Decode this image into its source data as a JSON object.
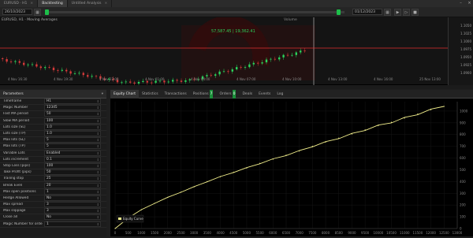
{
  "titlebar": {
    "tabs": [
      {
        "label": "EURUSD · H1",
        "active": false
      },
      {
        "label": "Backtesting",
        "active": true
      },
      {
        "label": "Untitled Analysis",
        "active": false
      }
    ]
  },
  "toolbar": {
    "start_date": "26/10/2023",
    "end_date": "01/12/2023"
  },
  "chart": {
    "info": "EURUSD, H1 · Moving Averages",
    "price_label": "57,587.45 | 19,362.41",
    "note": "Volume",
    "price_ticks": [
      "1.1050",
      "1.1025",
      "1.1000",
      "1.0975",
      "1.0950",
      "1.0925",
      "1.0900"
    ],
    "time_ticks": [
      "4 Nov 16:30",
      "4 Nov 19:30",
      "4 Nov 22:00",
      "4 Nov 01:00",
      "4 Nov 04:00",
      "4 Nov 07:00",
      "4 Nov 10:00",
      "4 Nov 13:00",
      "4 Nov 16:00",
      "25 Nov 13:00"
    ]
  },
  "params": {
    "header": "Parameters",
    "rows": [
      {
        "label": "Timeframe",
        "value": "H1"
      },
      {
        "label": "Magic Number",
        "value": "12345"
      },
      {
        "label": "Fast MA period",
        "value": "50"
      },
      {
        "label": "Slow MA period",
        "value": "100"
      },
      {
        "label": "Lots size (SL)",
        "value": "1.0"
      },
      {
        "label": "Lots size (TP)",
        "value": "1.0"
      },
      {
        "label": "Max lots (SL)",
        "value": "5"
      },
      {
        "label": "Max lots (TP)",
        "value": "5"
      },
      {
        "label": "Variable Lots",
        "value": "Enabled"
      },
      {
        "label": "Lots increment",
        "value": "0.1"
      },
      {
        "label": "Stop Loss (pips)",
        "value": "100"
      },
      {
        "label": "Take Profit (pips)",
        "value": "50"
      },
      {
        "label": "Trailing stop",
        "value": "25"
      },
      {
        "label": "Break Even",
        "value": "20"
      },
      {
        "label": "Max open positions",
        "value": "1"
      },
      {
        "label": "Hedge Allowed",
        "value": "No"
      },
      {
        "label": "Max spread",
        "value": "3"
      },
      {
        "label": "Max slippage",
        "value": "3"
      },
      {
        "label": "Close all",
        "value": "No"
      },
      {
        "label": "Magic Number for orders",
        "value": "1"
      }
    ]
  },
  "results": {
    "tabs": [
      {
        "label": "Equity Chart",
        "active": true
      },
      {
        "label": "Statistics",
        "active": false
      },
      {
        "label": "Transactions",
        "active": false
      },
      {
        "label": "Positions",
        "active": false,
        "badge": "7"
      },
      {
        "label": "Orders",
        "active": false,
        "badge": "0"
      },
      {
        "label": "Deals",
        "active": false
      },
      {
        "label": "Events",
        "active": false
      },
      {
        "label": "Log",
        "active": false
      }
    ],
    "legend": "Equity Curve"
  },
  "chart_data": {
    "type": "line",
    "title": "",
    "xlabel": "",
    "ylabel": "",
    "x": [
      0,
      500,
      1000,
      1500,
      2000,
      2500,
      3000,
      3500,
      4000,
      4500,
      5000,
      5500,
      6000,
      6500,
      7000,
      7500,
      8000,
      8500,
      9000,
      9500,
      10000,
      10500,
      11000,
      11500,
      12000,
      12500
    ],
    "series": [
      {
        "name": "Equity Curve",
        "values": [
          0,
          90,
          160,
          215,
          265,
          310,
          355,
          400,
          440,
          480,
          515,
          555,
          590,
          625,
          660,
          700,
          735,
          770,
          805,
          840,
          875,
          905,
          940,
          975,
          1010,
          1040
        ]
      }
    ],
    "xlim": [
      0,
      13000
    ],
    "ylim": [
      0,
      1080
    ],
    "color": "#f2ef8c",
    "grid": true
  },
  "colors": {
    "accent": "#1dbf4a",
    "resistance": "#e03030",
    "price_up": "#2ad35b",
    "price_down": "#d63a3a"
  }
}
